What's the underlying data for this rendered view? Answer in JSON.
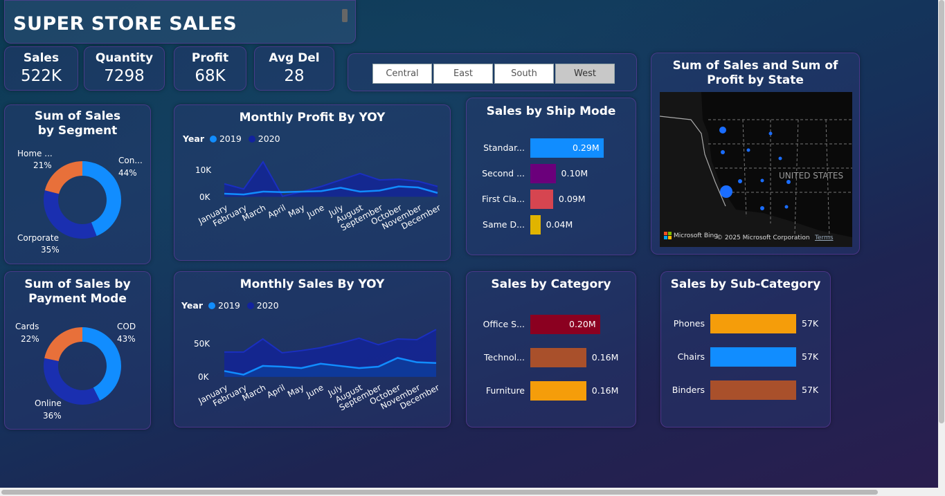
{
  "header": {
    "title": "SUPER STORE SALES"
  },
  "kpis": [
    {
      "label": "Sales",
      "value": "522K"
    },
    {
      "label": "Quantity",
      "value": "7298"
    },
    {
      "label": "Profit",
      "value": "68K"
    },
    {
      "label": "Avg Del",
      "value": "28"
    }
  ],
  "region_slicer": {
    "options": [
      "Central",
      "East",
      "South",
      "West"
    ],
    "selected": "West"
  },
  "map": {
    "title": "Sum of Sales and Sum of Profit by State",
    "country_label": "UNITED STATES",
    "attribution": "Microsoft Bing",
    "copyright": "© 2025 Microsoft Corporation",
    "terms": "Terms"
  },
  "segment_chart": {
    "title": "Sum of Sales by Segment",
    "slices": [
      {
        "label": "Con...",
        "pct": "44%",
        "value": 44,
        "color": "#118dff"
      },
      {
        "label": "Corporate",
        "pct": "35%",
        "value": 35,
        "color": "#1a2fb0"
      },
      {
        "label": "Home ...",
        "pct": "21%",
        "value": 21,
        "color": "#e8703a"
      }
    ]
  },
  "payment_chart": {
    "title": "Sum of Sales by Payment Mode",
    "slices": [
      {
        "label": "COD",
        "pct": "43%",
        "value": 43,
        "color": "#118dff"
      },
      {
        "label": "Online",
        "pct": "36%",
        "value": 36,
        "color": "#1a2fb0"
      },
      {
        "label": "Cards",
        "pct": "22%",
        "value": 22,
        "color": "#e8703a"
      }
    ]
  },
  "months": [
    "January",
    "February",
    "March",
    "April",
    "May",
    "June",
    "July",
    "August",
    "September",
    "October",
    "November",
    "December"
  ],
  "legend": {
    "title": "Year",
    "y1": "2019",
    "y2": "2020",
    "c1": "#118dff",
    "c2": "#12239e"
  },
  "profit_chart": {
    "title": "Monthly Profit By YOY",
    "ticks": [
      "10K",
      "0K"
    ]
  },
  "sales_chart": {
    "title": "Monthly Sales By YOY",
    "ticks": [
      "50K",
      "0K"
    ]
  },
  "chart_data": [
    {
      "type": "line",
      "title": "Monthly Profit By YOY",
      "x": [
        "January",
        "February",
        "March",
        "April",
        "May",
        "June",
        "July",
        "August",
        "September",
        "October",
        "November",
        "December"
      ],
      "ylim": [
        -2000,
        14000
      ],
      "series": [
        {
          "name": "2019",
          "values": [
            1200,
            900,
            2000,
            1800,
            2000,
            2200,
            3500,
            2000,
            2400,
            4000,
            3600,
            1500
          ]
        },
        {
          "name": "2020",
          "values": [
            5000,
            3000,
            13500,
            200,
            2000,
            4000,
            6500,
            9000,
            6500,
            6800,
            6000,
            4000
          ]
        }
      ]
    },
    {
      "type": "area",
      "title": "Monthly Sales By YOY",
      "x": [
        "January",
        "February",
        "March",
        "April",
        "May",
        "June",
        "July",
        "August",
        "September",
        "October",
        "November",
        "December"
      ],
      "ylim": [
        -5000,
        70000
      ],
      "series": [
        {
          "name": "2019",
          "values": [
            8000,
            3000,
            15000,
            14000,
            12000,
            18000,
            15000,
            12000,
            14000,
            26000,
            20000,
            19000
          ]
        },
        {
          "name": "2020",
          "values": [
            34000,
            34000,
            52000,
            33000,
            36000,
            40000,
            46000,
            53000,
            44000,
            52000,
            51000,
            65000
          ]
        }
      ]
    },
    {
      "type": "bar",
      "title": "Sales by Ship Mode",
      "categories": [
        "Standar...",
        "Second ...",
        "First Cla...",
        "Same D..."
      ],
      "values": [
        0.29,
        0.1,
        0.09,
        0.04
      ],
      "labels": [
        "0.29M",
        "0.10M",
        "0.09M",
        "0.04M"
      ],
      "colors": [
        "#118dff",
        "#6b007b",
        "#d64550",
        "#e0b400"
      ]
    },
    {
      "type": "bar",
      "title": "Sales by Category",
      "categories": [
        "Office S...",
        "Technol...",
        "Furniture"
      ],
      "values": [
        0.2,
        0.16,
        0.16
      ],
      "labels": [
        "0.20M",
        "0.16M",
        "0.16M"
      ],
      "colors": [
        "#8b0020",
        "#a9502b",
        "#f59d0a"
      ]
    },
    {
      "type": "bar",
      "title": "Sales by Sub-Category",
      "categories": [
        "Phones",
        "Chairs",
        "Binders"
      ],
      "values": [
        57,
        57,
        57
      ],
      "labels": [
        "57K",
        "57K",
        "57K"
      ],
      "colors": [
        "#f59d0a",
        "#118dff",
        "#a9502b"
      ]
    }
  ]
}
